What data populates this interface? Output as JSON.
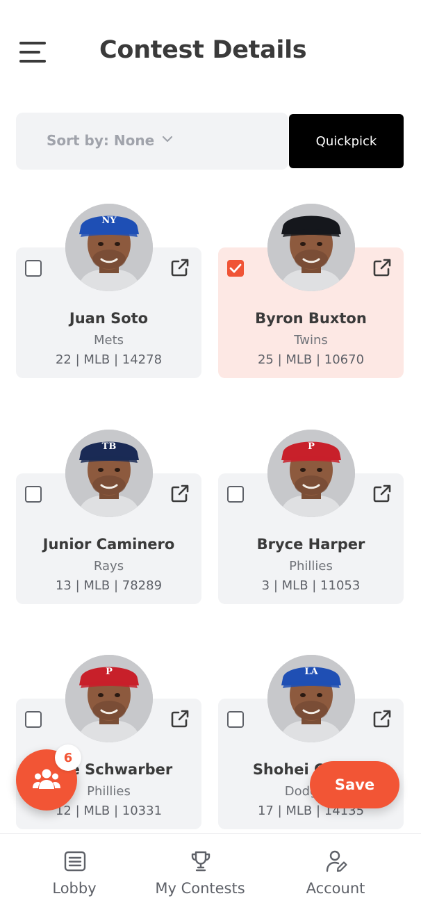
{
  "header": {
    "menu_icon": "hamburger-menu-icon",
    "title": "Contest Details"
  },
  "toolbar": {
    "sort_label": "Sort by: None",
    "sort_icon": "chevron-down-icon",
    "quickpick_label": "Quickpick"
  },
  "players": [
    {
      "name": "Juan Soto",
      "team": "Mets",
      "meta": "22 | MLB | 14278",
      "selected": false,
      "cap_color": "#1e4fb5",
      "cap_logo": "NY"
    },
    {
      "name": "Byron Buxton",
      "team": "Twins",
      "meta": "25 | MLB | 10670",
      "selected": true,
      "cap_color": "#15171c",
      "cap_logo": ""
    },
    {
      "name": "Junior Caminero",
      "team": "Rays",
      "meta": "13 | MLB | 78289",
      "selected": false,
      "cap_color": "#1a2a55",
      "cap_logo": "TB"
    },
    {
      "name": "Bryce Harper",
      "team": "Phillies",
      "meta": "3 | MLB | 11053",
      "selected": false,
      "cap_color": "#c8202a",
      "cap_logo": "P"
    },
    {
      "name": "Kyle Schwarber",
      "team": "Phillies",
      "meta": "12 | MLB | 10331",
      "selected": false,
      "cap_color": "#c8202a",
      "cap_logo": "P"
    },
    {
      "name": "Shohei Ohtani",
      "team": "Dodgers",
      "meta": "17 | MLB | 14135",
      "selected": false,
      "cap_color": "#1f4fb4",
      "cap_logo": "LA"
    }
  ],
  "actions": {
    "team_count": "6",
    "save_label": "Save"
  },
  "nav": {
    "items": [
      {
        "label": "Lobby",
        "icon": "list-icon"
      },
      {
        "label": "My Contests",
        "icon": "trophy-icon"
      },
      {
        "label": "Account",
        "icon": "user-edit-icon"
      }
    ]
  },
  "colors": {
    "accent": "#f25535",
    "selected_card": "#fde8e4",
    "card_bg": "#f2f3f5",
    "quickpick_bg": "#000000"
  }
}
